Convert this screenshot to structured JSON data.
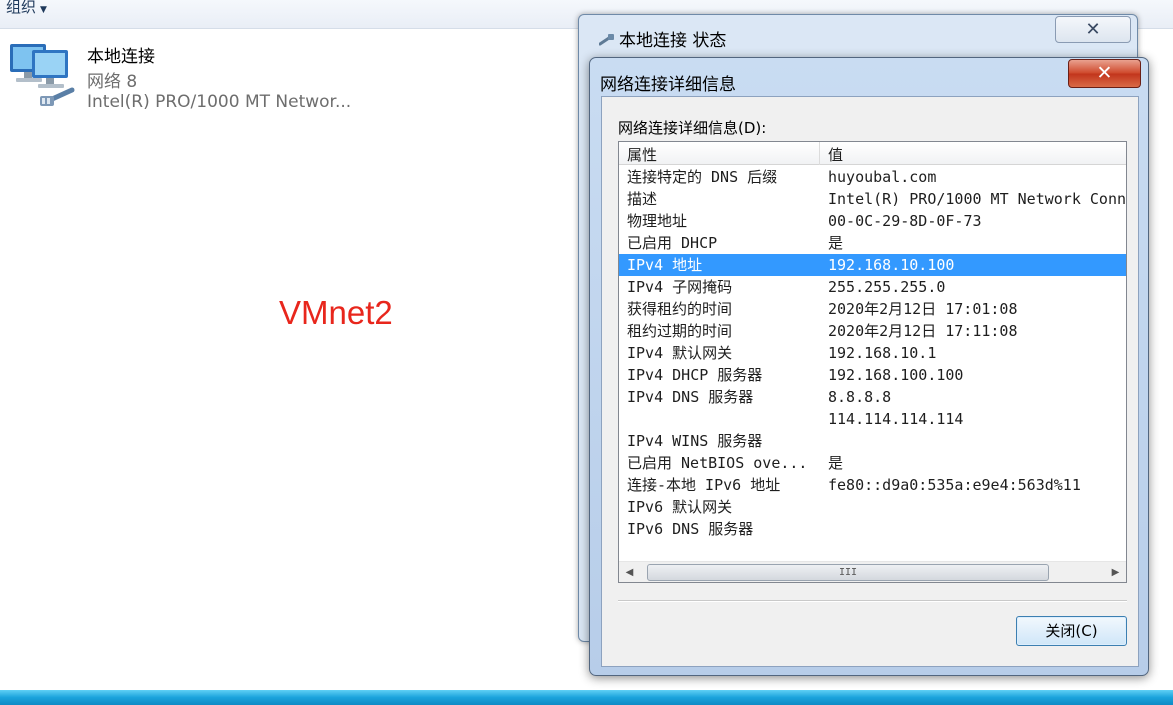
{
  "toolbar": {
    "organize_label": "组织"
  },
  "connection": {
    "name": "本地连接",
    "network": "网络 8",
    "device": "Intel(R) PRO/1000 MT Networ..."
  },
  "overlay_text": "VMnet2",
  "status_window": {
    "title": "本地连接 状态",
    "close_glyph": "✕"
  },
  "details_dialog": {
    "title": "网络连接详细信息",
    "close_glyph": "✕",
    "list_label": "网络连接详细信息(D):",
    "columns": {
      "property": "属性",
      "value": "值"
    },
    "rows": [
      {
        "property": "连接特定的 DNS 后缀",
        "value": "huyoubal.com"
      },
      {
        "property": "描述",
        "value": "Intel(R) PRO/1000 MT Network Conn"
      },
      {
        "property": "物理地址",
        "value": "00-0C-29-8D-0F-73"
      },
      {
        "property": "已启用 DHCP",
        "value": "是"
      },
      {
        "property": "IPv4 地址",
        "value": "192.168.10.100",
        "selected": true
      },
      {
        "property": "IPv4 子网掩码",
        "value": "255.255.255.0"
      },
      {
        "property": "获得租约的时间",
        "value": "2020年2月12日 17:01:08"
      },
      {
        "property": "租约过期的时间",
        "value": "2020年2月12日 17:11:08"
      },
      {
        "property": "IPv4 默认网关",
        "value": "192.168.10.1"
      },
      {
        "property": "IPv4 DHCP 服务器",
        "value": "192.168.100.100"
      },
      {
        "property": "IPv4 DNS 服务器",
        "value": "8.8.8.8"
      },
      {
        "property": "",
        "value": "114.114.114.114"
      },
      {
        "property": "IPv4 WINS 服务器",
        "value": ""
      },
      {
        "property": "已启用 NetBIOS ove...",
        "value": "是"
      },
      {
        "property": "连接-本地 IPv6 地址",
        "value": "fe80::d9a0:535a:e9e4:563d%11"
      },
      {
        "property": "IPv6 默认网关",
        "value": ""
      },
      {
        "property": "IPv6 DNS 服务器",
        "value": ""
      }
    ],
    "scroll_grip": "III",
    "close_button_label": "关闭(C)"
  },
  "colors": {
    "selection": "#3399ff",
    "overlay_text": "#e8261c",
    "taskbar": "#1aa3dc"
  }
}
